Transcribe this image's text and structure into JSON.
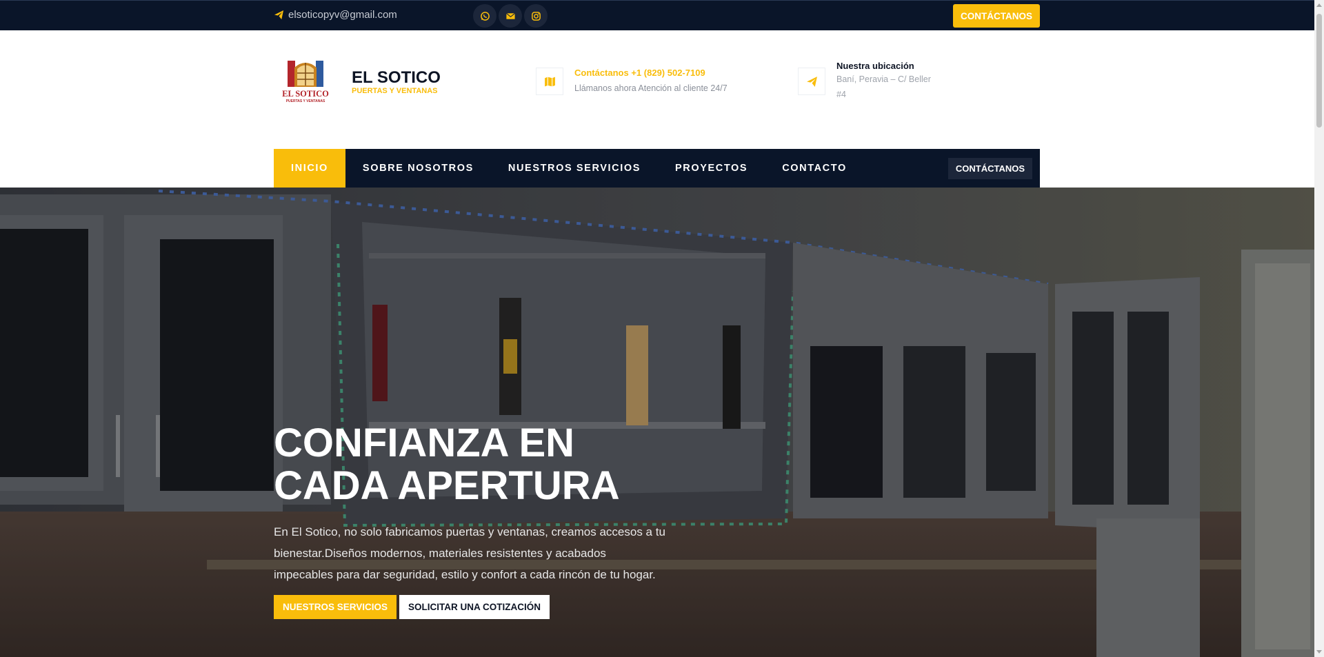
{
  "topbar": {
    "email": "elsoticopyv@gmail.com",
    "socials": [
      "whatsapp-icon",
      "envelope-icon",
      "instagram-icon"
    ],
    "cta_label": "CONTÁCTANOS"
  },
  "brand": {
    "name": "EL SOTICO",
    "tagline": "PUERTAS Y VENTANAS",
    "logo_text": "EL SOTICO",
    "logo_subtext": "PUERTAS Y VENTANAS"
  },
  "contact": {
    "phone_title": "Contáctanos +1 (829) 502-7109",
    "phone_sub": "Llámanos ahora Atención al cliente 24/7",
    "location_title": "Nuestra ubicación",
    "location_sub": "Baní, Peravia – C/ Beller #4"
  },
  "nav": {
    "items": [
      {
        "label": "INICIO",
        "active": true
      },
      {
        "label": "SOBRE NOSOTROS",
        "active": false
      },
      {
        "label": "NUESTROS SERVICIOS",
        "active": false
      },
      {
        "label": "PROYECTOS",
        "active": false
      },
      {
        "label": "CONTACTO",
        "active": false
      }
    ],
    "cta_label": "CONTÁCTANOS"
  },
  "hero": {
    "title_line1": "CONFIANZA EN",
    "title_line2": "CADA APERTURA",
    "description": "En El Sotico, no solo fabricamos puertas y ventanas, creamos accesos a tu bienestar.Diseños modernos, materiales resistentes y acabados impecables para dar seguridad, estilo y confort a cada rincón de tu hogar.",
    "btn_primary": "NUESTROS SERVICIOS",
    "btn_secondary": "SOLICITAR UNA COTIZACIÓN"
  },
  "colors": {
    "accent": "#f9bd0b",
    "navy": "#0a1529",
    "navy_light": "#1c263a"
  }
}
